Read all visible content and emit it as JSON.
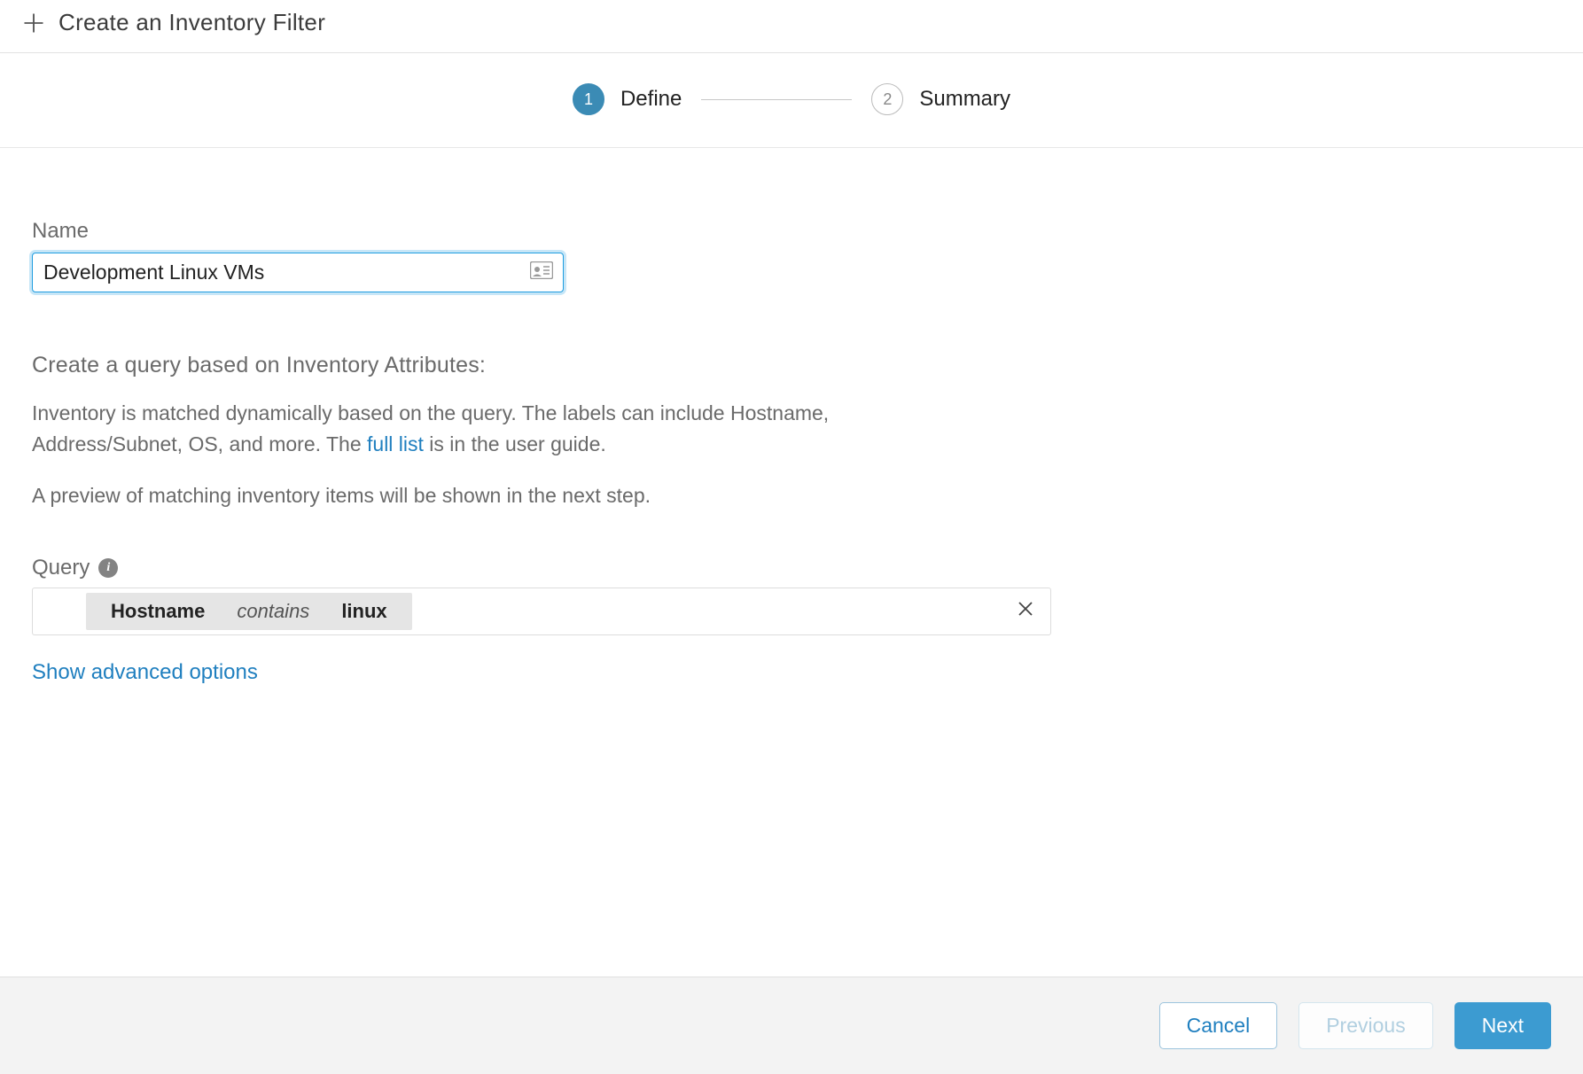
{
  "header": {
    "title": "Create an Inventory Filter"
  },
  "stepper": {
    "steps": [
      {
        "num": "1",
        "label": "Define",
        "active": true
      },
      {
        "num": "2",
        "label": "Summary",
        "active": false
      }
    ]
  },
  "form": {
    "name_label": "Name",
    "name_value": "Development Linux VMs"
  },
  "section": {
    "heading": "Create a query based on Inventory Attributes:",
    "desc_pre": "Inventory is matched dynamically based on the query. The labels can include Hostname, Address/Subnet, OS, and more. The ",
    "desc_link": "full list",
    "desc_post": " is in the user guide.",
    "preview_text": "A preview of matching inventory items will be shown in the next step."
  },
  "query": {
    "label": "Query",
    "chip": {
      "attribute": "Hostname",
      "operator": "contains",
      "value": "linux"
    }
  },
  "advanced_link": "Show advanced options",
  "footer": {
    "cancel": "Cancel",
    "previous": "Previous",
    "next": "Next"
  }
}
